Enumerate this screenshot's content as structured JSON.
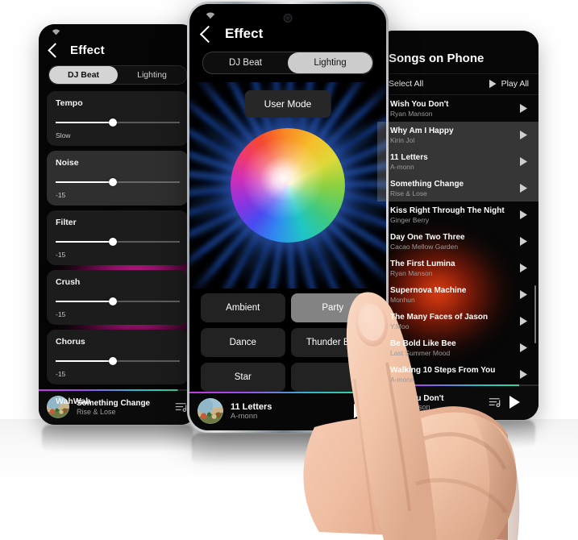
{
  "scene": {
    "background": "#ffffff",
    "description": "Three smartphones showing a music app; a hand taps the center phone"
  },
  "left_phone": {
    "status": {
      "wifi_icon": "wifi-icon"
    },
    "header": {
      "back_icon": "back-chevron-icon",
      "title": "Effect"
    },
    "tabs": [
      {
        "label": "DJ Beat",
        "selected": true
      },
      {
        "label": "Lighting",
        "selected": false
      }
    ],
    "effects": [
      {
        "name": "Tempo",
        "value": "Slow",
        "knob_pct": 46,
        "lit": false
      },
      {
        "name": "Noise",
        "value": "-15",
        "knob_pct": 46,
        "lit": true
      },
      {
        "name": "Filter",
        "value": "-15",
        "knob_pct": 46,
        "lit": true
      },
      {
        "name": "Crush",
        "value": "-15",
        "knob_pct": 46,
        "lit": false
      },
      {
        "name": "Chorus",
        "value": "-15",
        "knob_pct": 46,
        "lit": false
      },
      {
        "name": "WahWah",
        "value": "",
        "knob_pct": 46,
        "lit": false
      }
    ],
    "player": {
      "album_art": "album-art-thumbnail",
      "title": "Something Change",
      "artist": "Rise & Lose",
      "queue_icon": "queue-list-icon",
      "play_icon": "play-icon",
      "progress_pct": 88
    }
  },
  "center_phone": {
    "status": {
      "camera_icon": "front-camera-punch-hole"
    },
    "header": {
      "back_icon": "back-chevron-icon",
      "title": "Effect"
    },
    "tabs": [
      {
        "label": "DJ Beat",
        "selected": false
      },
      {
        "label": "Lighting",
        "selected": true
      }
    ],
    "user_mode_button": "User Mode",
    "color_wheel": {
      "icon": "color-wheel-picker",
      "center_highlight": "#ffffff",
      "glow_color": "#2f6bff"
    },
    "modes": [
      {
        "label": "Ambient",
        "selected": false
      },
      {
        "label": "Party",
        "selected": true
      },
      {
        "label": "Dance",
        "selected": false
      },
      {
        "label": "Thunder Bolt",
        "selected": false
      },
      {
        "label": "Star",
        "selected": false
      },
      {
        "label": "",
        "selected": false
      }
    ],
    "player": {
      "album_art": "album-art-thumbnail",
      "title": "11 Letters",
      "artist": "A-monn",
      "play_icon": "play-icon",
      "progress_pct": 82
    }
  },
  "right_phone": {
    "title": "Songs on Phone",
    "toolbar": {
      "select_all": "Select All",
      "play_all": "Play All",
      "play_all_icon": "play-outline-icon"
    },
    "songs": [
      {
        "title": "Wish You Don't",
        "artist": "Ryan Manson",
        "highlighted": false
      },
      {
        "title": "Why Am I Happy",
        "artist": "Kirin Jol",
        "highlighted": true
      },
      {
        "title": "11 Letters",
        "artist": "A-monn",
        "highlighted": true
      },
      {
        "title": "Something Change",
        "artist": "Rise & Lose",
        "highlighted": true
      },
      {
        "title": "Kiss Right Through The Night",
        "artist": "Ginger Berry",
        "highlighted": false
      },
      {
        "title": "Day One Two Three",
        "artist": "Cacao Mellow Garden",
        "highlighted": false
      },
      {
        "title": "The First Lumina",
        "artist": "Ryan Manson",
        "highlighted": false
      },
      {
        "title": "Supernova Machine",
        "artist": "Monhun",
        "highlighted": false
      },
      {
        "title": "The Many Faces of Jason",
        "artist": "Y.Moo",
        "highlighted": false
      },
      {
        "title": "Be Bold Like Bee",
        "artist": "Last Summer Mood",
        "highlighted": false
      },
      {
        "title": "Walking 10 Steps From You",
        "artist": "A-monn",
        "highlighted": false
      }
    ],
    "player": {
      "album_art": "album-art-thumbnail",
      "title": "Wish You Don't",
      "artist": "Ryan Manson",
      "queue_icon": "queue-list-icon",
      "play_icon": "play-icon",
      "progress_pct": 86
    }
  },
  "colors": {
    "accent_pink": "#ff28be",
    "accent_red": "#ff4614",
    "accent_blue": "#2f6bff",
    "selected_tab_bg": "#cccccc"
  }
}
